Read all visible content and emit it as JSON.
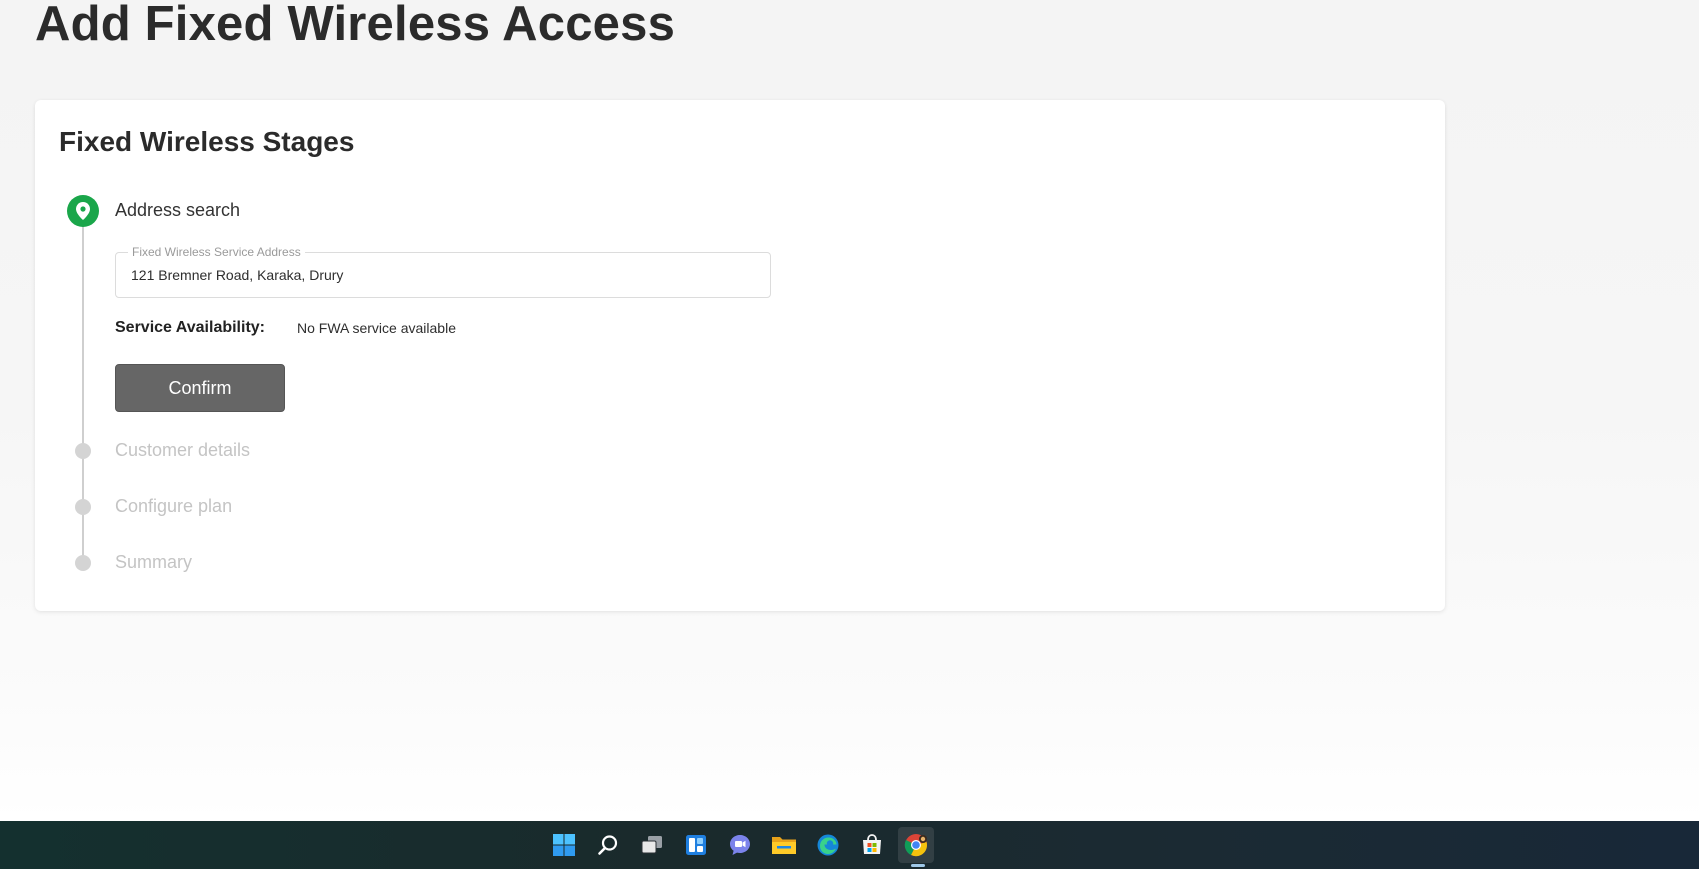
{
  "page": {
    "title": "Add Fixed Wireless Access"
  },
  "card": {
    "title": "Fixed Wireless Stages"
  },
  "steps": [
    {
      "label": "Address search",
      "state": "active",
      "icon": "location-pin-icon"
    },
    {
      "label": "Customer details",
      "state": "inactive"
    },
    {
      "label": "Configure plan",
      "state": "inactive"
    },
    {
      "label": "Summary",
      "state": "inactive"
    }
  ],
  "address": {
    "legend": "Fixed Wireless Service Address",
    "value": "121 Bremner Road, Karaka, Drury"
  },
  "availability": {
    "label": "Service Availability:",
    "value": "No FWA service available"
  },
  "confirm_button": {
    "label": "Confirm"
  },
  "taskbar": {
    "icons": [
      "windows-start-icon",
      "search-icon",
      "task-view-icon",
      "widgets-icon",
      "teams-chat-icon",
      "file-explorer-icon",
      "edge-browser-icon",
      "microsoft-store-icon",
      "chrome-browser-icon"
    ],
    "active_app": "chrome-browser-icon"
  },
  "colors": {
    "accent_green": "#1aa64a",
    "button_gray": "#666666",
    "inactive_text": "#c4c4c4"
  }
}
